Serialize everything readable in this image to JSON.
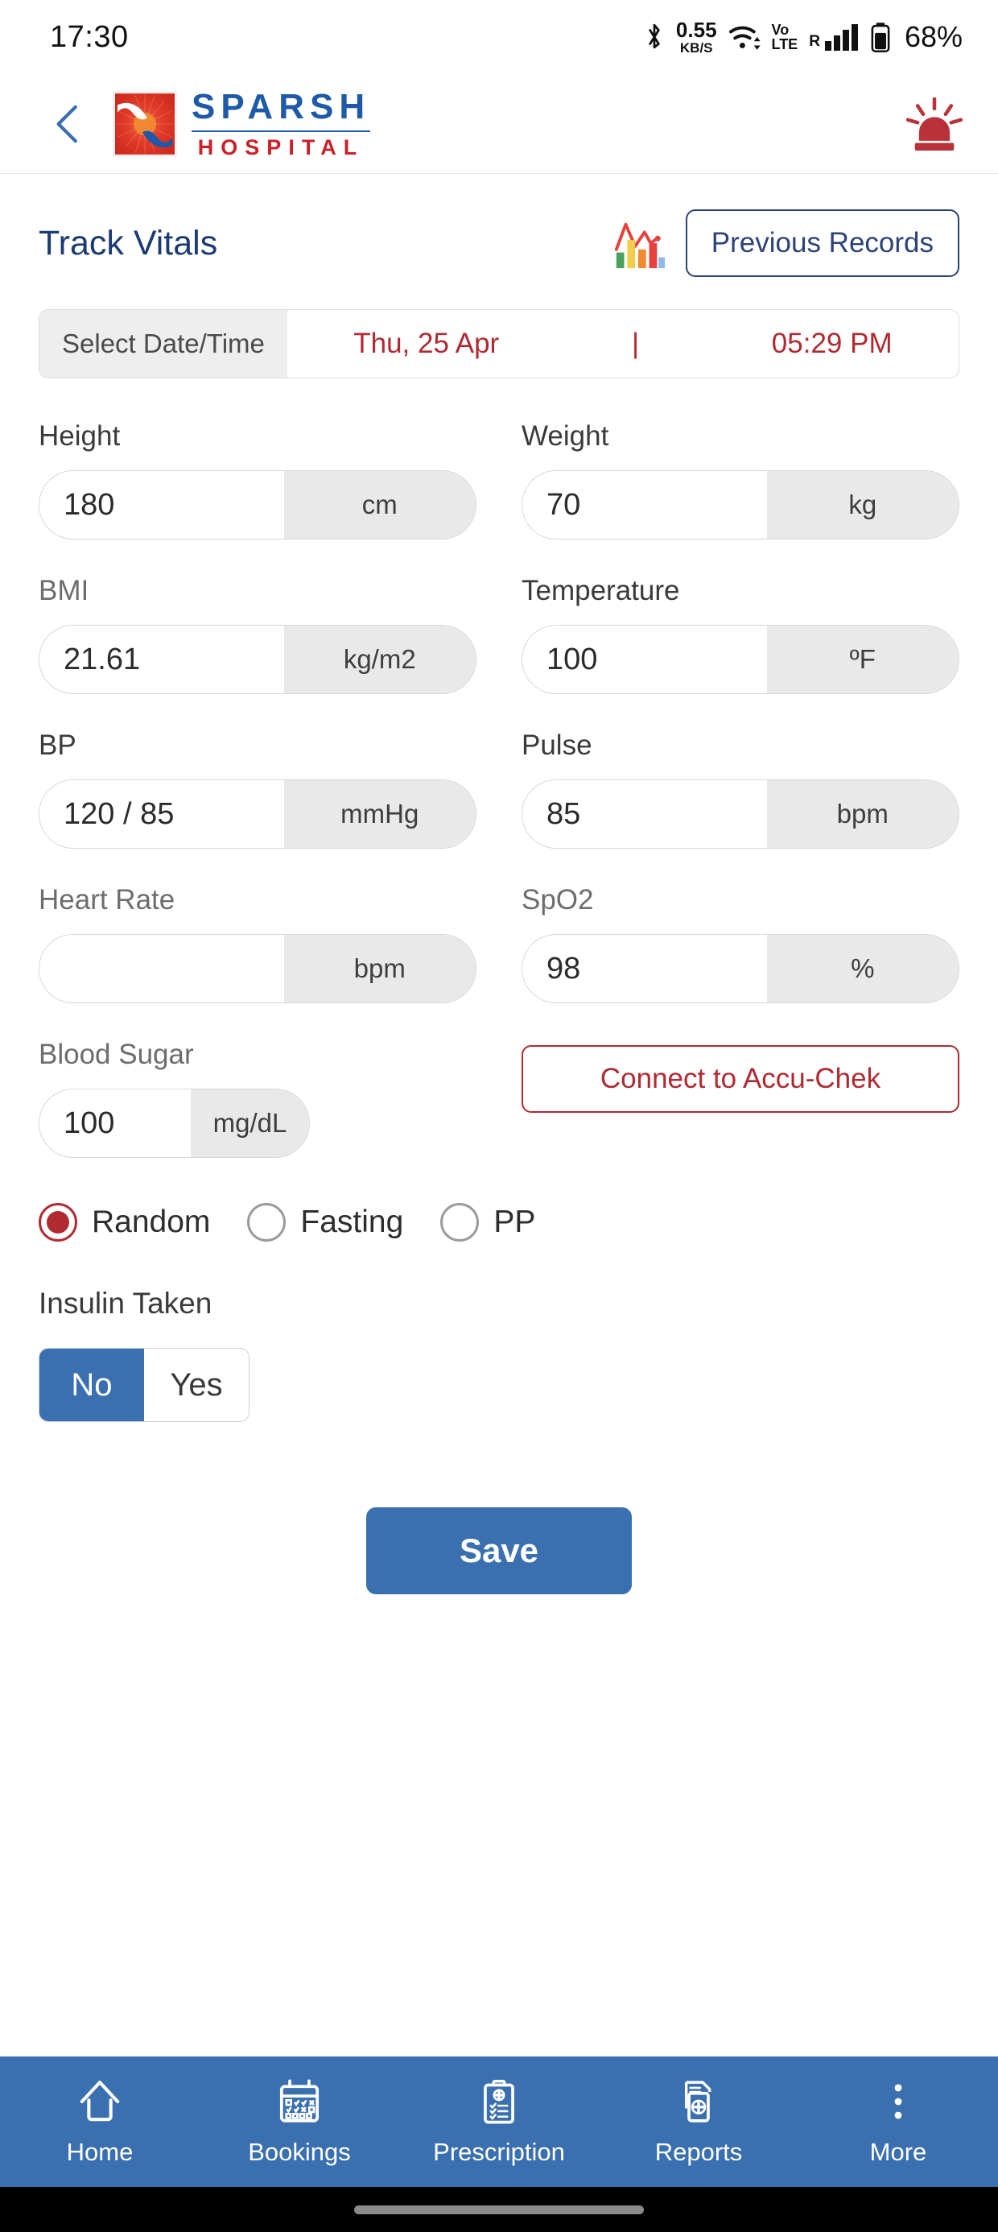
{
  "status_bar": {
    "time": "17:30",
    "bluetooth_icon": "bluetooth-icon",
    "data_rate_value": "0.55",
    "data_rate_unit": "KB/S",
    "wifi_icon": "wifi-icon",
    "volte_line1": "Vo",
    "volte_line2": "LTE",
    "roaming": "R",
    "battery_percent": "68%"
  },
  "app_bar": {
    "back_icon": "chevron-left-icon",
    "logo_primary": "SPARSH",
    "logo_secondary": "HOSPITAL",
    "emergency_icon": "siren-icon"
  },
  "header": {
    "page_title": "Track Vitals",
    "chart_icon": "bar-chart-icon",
    "previous_records_label": "Previous Records"
  },
  "date_time": {
    "label": "Select Date/Time",
    "date": "Thu, 25 Apr",
    "separator": "|",
    "time": "05:29 PM"
  },
  "fields": {
    "height": {
      "label": "Height",
      "value": "180",
      "unit": "cm"
    },
    "weight": {
      "label": "Weight",
      "value": "70",
      "unit": "kg"
    },
    "bmi": {
      "label": "BMI",
      "value": "21.61",
      "unit": "kg/m2"
    },
    "temperature": {
      "label": "Temperature",
      "value": "100",
      "unit": "ºF"
    },
    "bp": {
      "label": "BP",
      "value": "120  / 85",
      "unit": "mmHg"
    },
    "pulse": {
      "label": "Pulse",
      "value": "85",
      "unit": "bpm"
    },
    "heart_rate": {
      "label": "Heart Rate",
      "value": "",
      "unit": "bpm"
    },
    "spo2": {
      "label": "SpO2",
      "value": "98",
      "unit": "%"
    },
    "blood_sugar": {
      "label": "Blood Sugar",
      "value": "100",
      "unit": "mg/dL"
    }
  },
  "accu_chek": {
    "label": "Connect to Accu-Chek"
  },
  "sugar_type": {
    "options": [
      {
        "label": "Random",
        "selected": true
      },
      {
        "label": "Fasting",
        "selected": false
      },
      {
        "label": "PP",
        "selected": false
      }
    ]
  },
  "insulin": {
    "label": "Insulin Taken",
    "no_label": "No",
    "yes_label": "Yes",
    "selected": "No"
  },
  "save": {
    "label": "Save"
  },
  "bottom_nav": {
    "items": [
      {
        "label": "Home",
        "icon": "home-icon"
      },
      {
        "label": "Bookings",
        "icon": "calendar-icon"
      },
      {
        "label": "Prescription",
        "icon": "clipboard-medical-icon"
      },
      {
        "label": "Reports",
        "icon": "documents-medical-icon"
      },
      {
        "label": "More",
        "icon": "kebab-menu-icon"
      }
    ]
  },
  "colors": {
    "brand_blue": "#3a6fb0",
    "navy": "#2c4278",
    "brand_red": "#b02a32",
    "logo_blue": "#1f5aa8",
    "logo_red": "#cc2028"
  }
}
